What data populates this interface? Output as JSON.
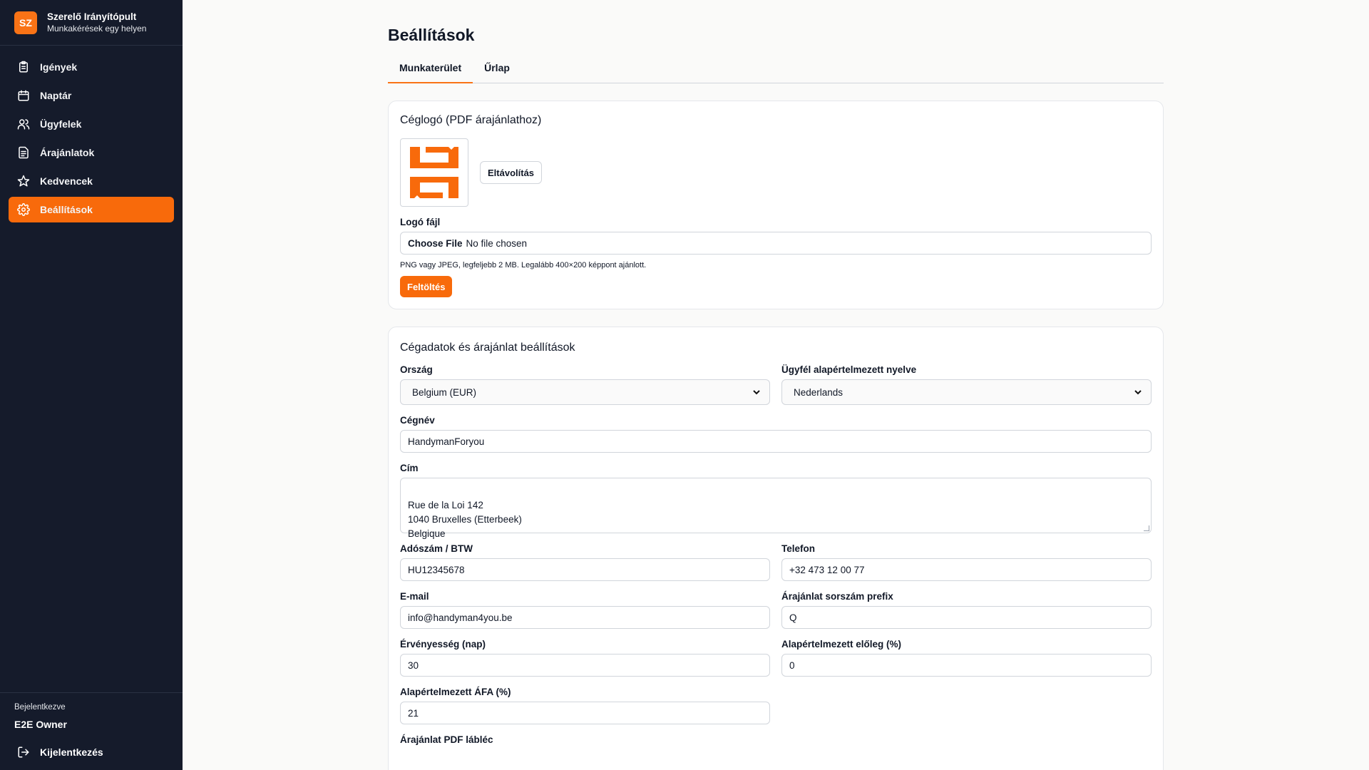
{
  "brand": {
    "initials": "SZ",
    "title": "Szerelő Irányítópult",
    "subtitle": "Munkakérések egy helyen",
    "accent": "#f97316"
  },
  "nav": [
    {
      "label": "Igények",
      "icon": "clipboard-icon"
    },
    {
      "label": "Naptár",
      "icon": "calendar-icon"
    },
    {
      "label": "Ügyfelek",
      "icon": "users-icon"
    },
    {
      "label": "Árajánlatok",
      "icon": "document-icon"
    },
    {
      "label": "Kedvencek",
      "icon": "star-icon"
    },
    {
      "label": "Beállítások",
      "icon": "gear-icon",
      "active": true
    }
  ],
  "footer": {
    "logged_label": "Bejelentkezve",
    "user": "E2E Owner",
    "logout": "Kijelentkezés"
  },
  "page": {
    "title": "Beállítások",
    "tabs": [
      "Munkaterület",
      "Űrlap"
    ],
    "active_tab": "Munkaterület"
  },
  "logo_card": {
    "title": "Céglogó (PDF árajánlathoz)",
    "remove_button": "Eltávolítás",
    "file_label": "Logó fájl",
    "choose_file": "Choose File",
    "no_file": "No file chosen",
    "hint": "PNG vagy JPEG, legfeljebb 2 MB. Legalább 400×200 képpont ajánlott.",
    "upload_button": "Feltöltés"
  },
  "company_card": {
    "title": "Cégadatok és árajánlat beállítások",
    "country_label": "Ország",
    "country_value": "Belgium (EUR)",
    "language_label": "Ügyfél alapértelmezett nyelve",
    "language_value": "Nederlands",
    "name_label": "Cégnév",
    "name_value": "HandymanForyou",
    "address_label": "Cím",
    "address_value": "Rue de la Loi 142\n1040 Bruxelles (Etterbeek)\nBelgique",
    "tax_label": "Adószám / BTW",
    "tax_value": "HU12345678",
    "phone_label": "Telefon",
    "phone_value": "+32 473 12 00 77",
    "email_label": "E-mail",
    "email_value": "info@handyman4you.be",
    "prefix_label": "Árajánlat sorszám prefix",
    "prefix_value": "Q",
    "validity_label": "Érvényesség (nap)",
    "validity_value": "30",
    "deposit_label": "Alapértelmezett előleg (%)",
    "deposit_value": "0",
    "vat_label": "Alapértelmezett ÁFA (%)",
    "vat_value": "21",
    "footer_label": "Árajánlat PDF lábléc"
  }
}
